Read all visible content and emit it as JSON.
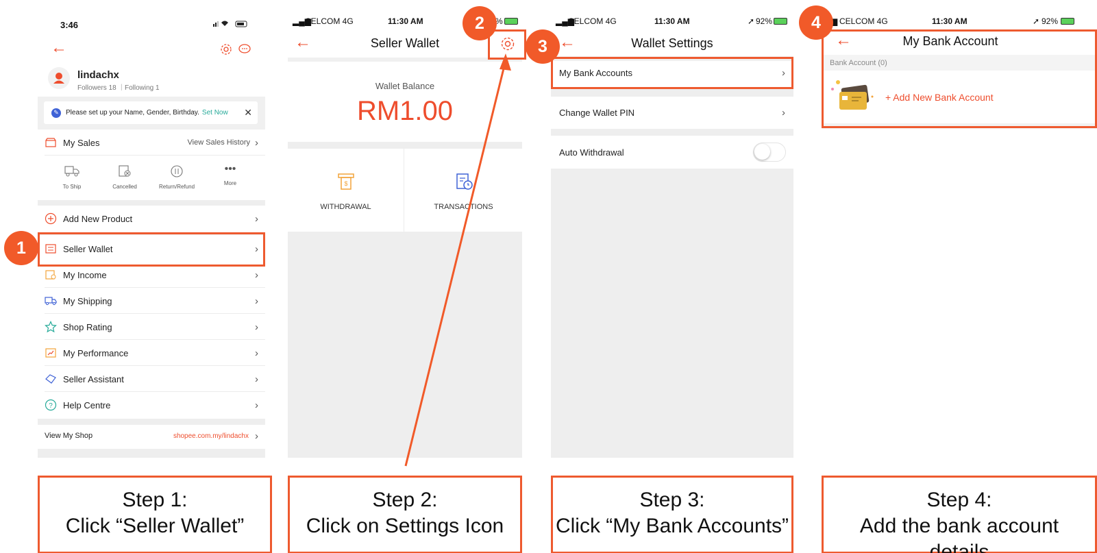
{
  "panel1": {
    "time": "3:46",
    "username": "lindachx",
    "followers": "Followers 18",
    "following": "Following 1",
    "notice_text": "Please set up your Name, Gender, Birthday.",
    "notice_link": "Set Now",
    "my_sales": "My Sales",
    "view_sales_history": "View Sales History",
    "sales_shortcuts": [
      "To Ship",
      "Cancelled",
      "Return/Refund",
      "More"
    ],
    "menu": [
      "Add New Product",
      "Seller Wallet",
      "My Income",
      "My Shipping",
      "Shop Rating",
      "My Performance",
      "Seller Assistant",
      "Help Centre"
    ],
    "view_my_shop": "View My Shop",
    "shop_url": "shopee.com.my/lindachx"
  },
  "panel2": {
    "carrier": "CELCOM  4G",
    "time": "11:30 AM",
    "battery": "%",
    "title": "Seller Wallet",
    "balance_label": "Wallet Balance",
    "balance_value": "RM1.00",
    "withdrawal": "WITHDRAWAL",
    "transactions": "TRANSACTIONS"
  },
  "panel3": {
    "carrier": "CELCOM  4G",
    "time": "11:30 AM",
    "battery": "92%",
    "title": "Wallet Settings",
    "items": [
      "My Bank Accounts",
      "Change Wallet PIN",
      "Auto Withdrawal"
    ]
  },
  "panel4": {
    "carrier": "CELCOM  4G",
    "time": "11:30 AM",
    "battery": "92%",
    "title": "My Bank Account",
    "section_label": "Bank Account (0)",
    "add_label": "+ Add New Bank Account"
  },
  "badges": [
    "1",
    "2",
    "3",
    "4"
  ],
  "steps": [
    {
      "line1": "Step 1:",
      "line2": "Click “Seller Wallet”"
    },
    {
      "line1": "Step 2:",
      "line2": "Click on Settings Icon"
    },
    {
      "line1": "Step 3:",
      "line2": "Click “My Bank Accounts”"
    },
    {
      "line1": "Step 4:",
      "line2": "Add the bank account details"
    }
  ],
  "colors": {
    "accent": "#ee4d2d",
    "annotation": "#f15a29",
    "teal": "#26aa99"
  },
  "icons": [
    "back-arrow-icon",
    "gear-icon",
    "chat-icon",
    "shop-icon",
    "truck-icon",
    "cancel-icon",
    "refund-icon",
    "more-icon",
    "plus-circle-icon",
    "wallet-icon",
    "income-icon",
    "shipping-icon",
    "star-icon",
    "performance-icon",
    "assistant-icon",
    "help-icon",
    "atm-icon",
    "transactions-icon",
    "toggle-icon",
    "bank-card-icon"
  ]
}
